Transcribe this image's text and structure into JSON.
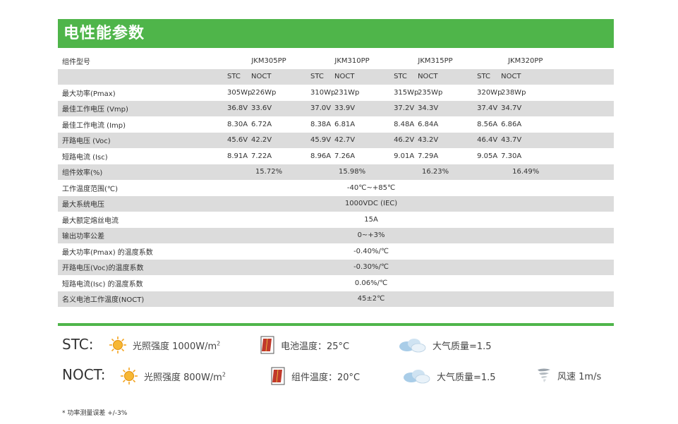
{
  "title": "电性能参数",
  "models_label": "组件型号",
  "models": [
    "JKM305PP",
    "JKM310PP",
    "JKM315PP",
    "JKM320PP"
  ],
  "stc_label": "STC",
  "noct_label": "NOCT",
  "per_model_rows": [
    {
      "label": "最大功率(Pmax)",
      "values": [
        [
          "305Wp",
          "226Wp"
        ],
        [
          "310Wp",
          "231Wp"
        ],
        [
          "315Wp",
          "235Wp"
        ],
        [
          "320Wp",
          "238Wp"
        ]
      ]
    },
    {
      "label": "最佳工作电压 (Vmp)",
      "values": [
        [
          "36.8V",
          "33.6V"
        ],
        [
          "37.0V",
          "33.9V"
        ],
        [
          "37.2V",
          "34.3V"
        ],
        [
          "37.4V",
          "34.7V"
        ]
      ]
    },
    {
      "label": "最佳工作电流 (Imp)",
      "values": [
        [
          "8.30A",
          "6.72A"
        ],
        [
          "8.38A",
          "6.81A"
        ],
        [
          "8.48A",
          "6.84A"
        ],
        [
          "8.56A",
          "6.86A"
        ]
      ]
    },
    {
      "label": "开路电压 (Voc)",
      "values": [
        [
          "45.6V",
          "42.2V"
        ],
        [
          "45.9V",
          "42.7V"
        ],
        [
          "46.2V",
          "43.2V"
        ],
        [
          "46.4V",
          "43.7V"
        ]
      ]
    },
    {
      "label": "短路电流 (Isc)",
      "values": [
        [
          "8.91A",
          "7.22A"
        ],
        [
          "8.96A",
          "7.26A"
        ],
        [
          "9.01A",
          "7.29A"
        ],
        [
          "9.05A",
          "7.30A"
        ]
      ]
    }
  ],
  "efficiency": {
    "label": "组件效率(%)",
    "values": [
      "15.72%",
      "15.98%",
      "16.23%",
      "16.49%"
    ]
  },
  "common_rows": [
    {
      "label": "工作温度范围(℃)",
      "value": "-40℃~+85℃"
    },
    {
      "label": "最大系统电压",
      "value": "1000VDC (IEC)"
    },
    {
      "label": "最大额定熔丝电流",
      "value": "15A"
    },
    {
      "label": "输出功率公差",
      "value": "0~+3%"
    },
    {
      "label": "最大功率(Pmax) 的温度系数",
      "value": "-0.40%/℃"
    },
    {
      "label": "开路电压(Voc)的温度系数",
      "value": "-0.30%/℃"
    },
    {
      "label": "短路电流(Isc) 的温度系数",
      "value": "0.06%/℃"
    },
    {
      "label": "名义电池工作温度(NOCT)",
      "value": "45±2℃"
    }
  ],
  "conditions": {
    "stc": {
      "label": "STC:",
      "irradiance": "光照强度  1000W/m",
      "irradiance_sup": "2",
      "temperature": "电池温度：25°C",
      "air_mass": "大气质量=1.5"
    },
    "noct": {
      "label": "NOCT:",
      "irradiance": "光照强度  800W/m",
      "irradiance_sup": "2",
      "temperature": "组件温度：20°C",
      "air_mass": "大气质量=1.5",
      "wind": "风速  1m/s"
    }
  },
  "footnote": "* 功率测量误差  +/-3%",
  "colors": {
    "brand_green": "#4fb54a",
    "row_shade": "#dcdcdc",
    "sun": "#f5a623",
    "cell": "#c0392b"
  },
  "icons": [
    "sun-icon",
    "solar-cell-icon",
    "cloud-icon",
    "wind-icon"
  ]
}
